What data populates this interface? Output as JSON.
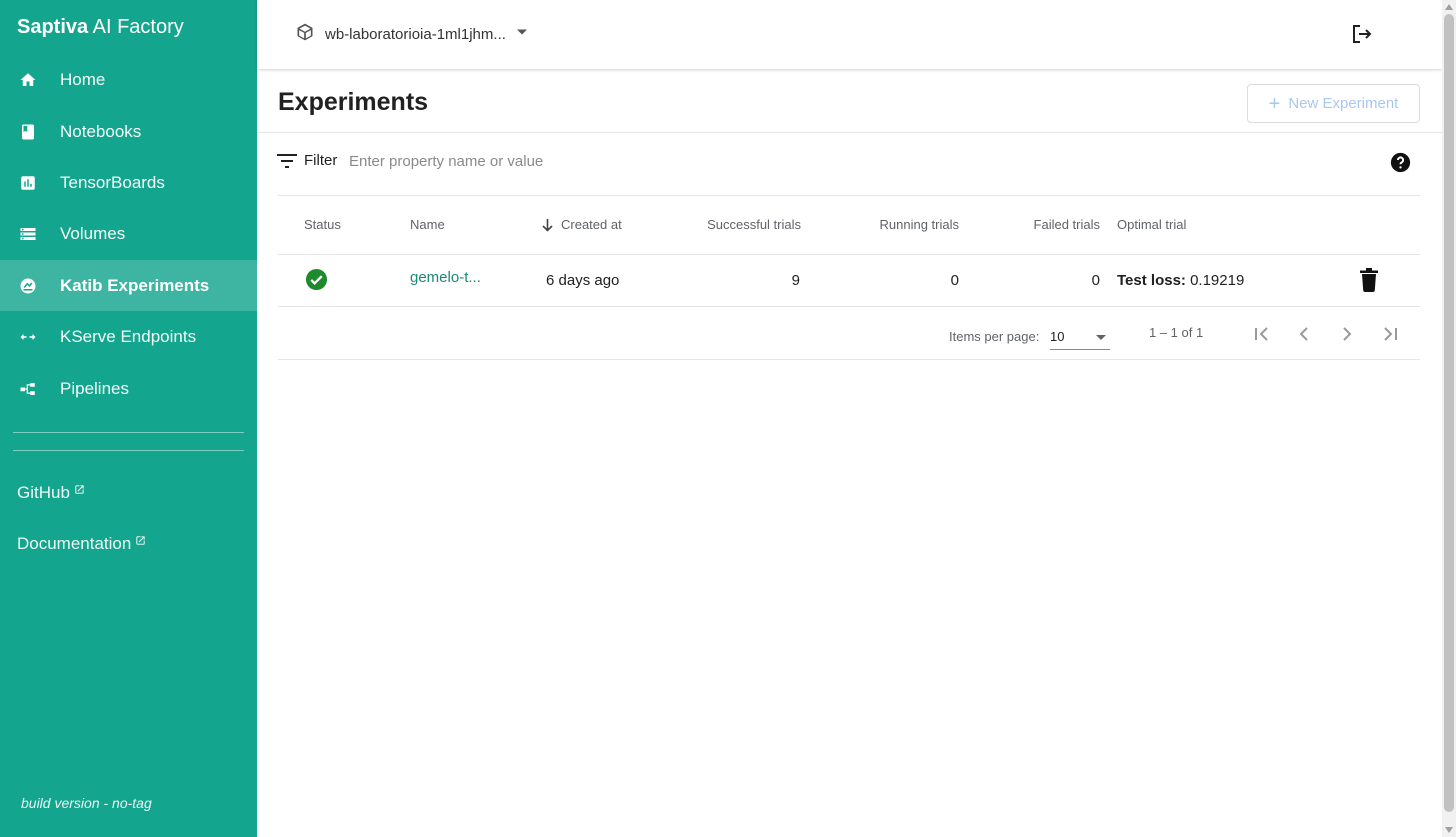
{
  "brand": {
    "name_bold": "Saptiva",
    "name_rest": " AI Factory"
  },
  "sidebar": {
    "items": [
      {
        "label": "Home",
        "icon": "home-icon"
      },
      {
        "label": "Notebooks",
        "icon": "notebook-icon"
      },
      {
        "label": "TensorBoards",
        "icon": "bar-chart-icon"
      },
      {
        "label": "Volumes",
        "icon": "storage-icon"
      },
      {
        "label": "Katib Experiments",
        "icon": "katib-icon",
        "active": true
      },
      {
        "label": "KServe Endpoints",
        "icon": "swap-horizontal-icon"
      },
      {
        "label": "Pipelines",
        "icon": "pipeline-icon"
      }
    ],
    "links": [
      {
        "label": "GitHub",
        "icon": "external-link-icon"
      },
      {
        "label": "Documentation",
        "icon": "external-link-icon"
      }
    ],
    "build": "build version - no-tag"
  },
  "topbar": {
    "namespace": "wb-laboratorioia-1ml1jhm...",
    "namespace_icon": "cube-icon",
    "logout_icon": "logout-icon"
  },
  "page": {
    "title": "Experiments",
    "new_button": "New Experiment"
  },
  "filter": {
    "label": "Filter",
    "placeholder": "Enter property name or value"
  },
  "table": {
    "columns": {
      "status": "Status",
      "name": "Name",
      "created": "Created at",
      "successful": "Successful trials",
      "running": "Running trials",
      "failed": "Failed trials",
      "optimal": "Optimal trial"
    },
    "rows": [
      {
        "status": "succeeded",
        "name": "gemelo-t...",
        "created": "6 days ago",
        "successful": "9",
        "running": "0",
        "failed": "0",
        "optimal_label": "Test loss:",
        "optimal_value": " 0.19219"
      }
    ]
  },
  "pagination": {
    "items_per_page_label": "Items per page:",
    "items_per_page": "10",
    "range": "1 – 1 of 1"
  },
  "colors": {
    "sidebar": "#14a58e",
    "link": "#1a8a7a",
    "success": "#1e8a2e",
    "disabled_button_text": "#a8c8f0"
  }
}
